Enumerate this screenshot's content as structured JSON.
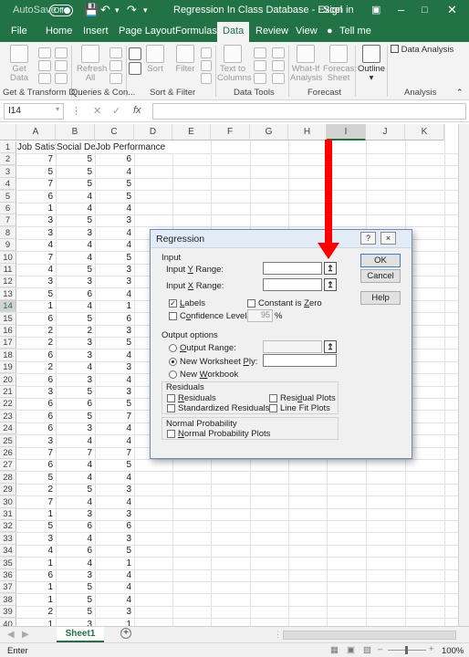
{
  "titlebar": {
    "autosave": "AutoSave",
    "toggle": "Off",
    "title": "Regression In Class Database  -  Excel",
    "sign_in": "Sign in"
  },
  "tabs": [
    "File",
    "Home",
    "Insert",
    "Page Layout",
    "Formulas",
    "Data",
    "Review",
    "View",
    "Tell me"
  ],
  "active_tab": "Data",
  "ribbon": {
    "get_data": [
      "Get",
      "Data"
    ],
    "refresh": [
      "Refresh",
      "All"
    ],
    "sort": "Sort",
    "filter": "Filter",
    "text_to_columns": [
      "Text to",
      "Columns"
    ],
    "what_if": [
      "What-If",
      "Analysis"
    ],
    "forecast_sheet": [
      "Forecast",
      "Sheet"
    ],
    "outline": "Outline",
    "data_analysis": "Data Analysis",
    "groups": [
      "Get & Transform D...",
      "Queries & Con...",
      "Sort & Filter",
      "Data Tools",
      "Forecast",
      "Analysis"
    ]
  },
  "formula_bar": {
    "name_box": "I14",
    "formula": ""
  },
  "columns": [
    "A",
    "B",
    "C",
    "D",
    "E",
    "F",
    "G",
    "H",
    "I",
    "J",
    "K"
  ],
  "headers": [
    "Job Satisfaction",
    "Social Desirability",
    "Job Performance"
  ],
  "header_text": {
    "A": "Job Satisf",
    "B": "Social Des",
    "C": "Job Performance"
  },
  "rows": [
    [
      7,
      5,
      6
    ],
    [
      5,
      5,
      4
    ],
    [
      7,
      5,
      5
    ],
    [
      6,
      4,
      5
    ],
    [
      1,
      4,
      4
    ],
    [
      3,
      5,
      3
    ],
    [
      3,
      3,
      4
    ],
    [
      4,
      4,
      4
    ],
    [
      7,
      4,
      5
    ],
    [
      4,
      5,
      3
    ],
    [
      3,
      3,
      3
    ],
    [
      5,
      6,
      4
    ],
    [
      1,
      4,
      1
    ],
    [
      6,
      5,
      6
    ],
    [
      2,
      2,
      3
    ],
    [
      2,
      3,
      5
    ],
    [
      6,
      3,
      4
    ],
    [
      2,
      4,
      3
    ],
    [
      6,
      3,
      4
    ],
    [
      3,
      5,
      3
    ],
    [
      6,
      6,
      5
    ],
    [
      6,
      5,
      7
    ],
    [
      6,
      3,
      4
    ],
    [
      3,
      4,
      4
    ],
    [
      7,
      7,
      7
    ],
    [
      6,
      4,
      5
    ],
    [
      5,
      4,
      4
    ],
    [
      2,
      5,
      3
    ],
    [
      7,
      4,
      4
    ],
    [
      1,
      3,
      3
    ],
    [
      5,
      6,
      6
    ],
    [
      3,
      4,
      3
    ],
    [
      4,
      6,
      5
    ],
    [
      1,
      4,
      1
    ],
    [
      6,
      3,
      4
    ],
    [
      1,
      5,
      4
    ],
    [
      1,
      5,
      4
    ],
    [
      2,
      5,
      3
    ],
    [
      1,
      3,
      1
    ]
  ],
  "row_numbers": [
    1,
    2,
    3,
    4,
    5,
    6,
    7,
    8,
    9,
    10,
    11,
    12,
    13,
    14,
    15,
    16,
    17,
    18,
    19,
    20,
    21,
    22,
    23,
    24,
    25,
    26,
    27,
    28,
    29,
    30,
    31,
    32,
    33,
    34,
    35,
    36,
    37,
    38,
    39,
    40
  ],
  "selected_cell": "I14",
  "sheet_tab": "Sheet1",
  "status": {
    "mode": "Enter",
    "zoom": "100%"
  },
  "dialog": {
    "title": "Regression",
    "help": "?",
    "close": "×",
    "input_section": "Input",
    "input_y": "Input Y Range:",
    "input_x": "Input X Range:",
    "labels": "Labels",
    "labels_checked": true,
    "constant_zero": "Constant is Zero",
    "confidence_level": "Confidence Level:",
    "confidence_value": "95",
    "percent": "%",
    "output_options": "Output options",
    "output_range": "Output Range:",
    "new_ws_ply": "New Worksheet Ply:",
    "new_workbook": "New Workbook",
    "residuals_section": "Residuals",
    "residuals": "Residuals",
    "std_residuals": "Standardized Residuals",
    "residual_plots": "Residual Plots",
    "line_fit_plots": "Line Fit Plots",
    "normal_prob_section": "Normal Probability",
    "normal_prob_plots": "Normal Probability Plots",
    "ok": "OK",
    "cancel": "Cancel",
    "help_button": "Help"
  },
  "colors": {
    "excel_green": "#217346",
    "arrow": "#ff0000"
  }
}
